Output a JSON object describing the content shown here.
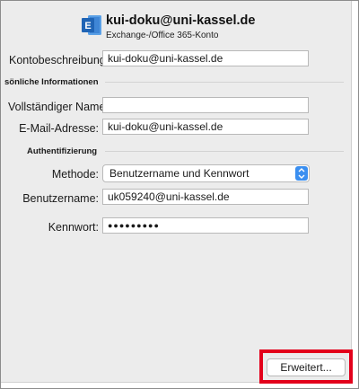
{
  "account": {
    "email": "kui-doku@uni-kassel.de",
    "type": "Exchange-/Office 365-Konto",
    "icon": "exchange-icon"
  },
  "fields": {
    "description_label": "Kontobeschreibung:",
    "description_value": "kui-doku@uni-kassel.de",
    "personal_section": "sönliche Informationen",
    "fullname_label": "Vollständiger Name:",
    "fullname_value": "",
    "email_label": "E-Mail-Adresse:",
    "email_value": "kui-doku@uni-kassel.de",
    "auth_section": "Authentifizierung",
    "method_label": "Methode:",
    "method_value": "Benutzername und Kennwort",
    "username_label": "Benutzername:",
    "username_value": "uk059240@uni-kassel.de",
    "password_label": "Kennwort:",
    "password_value": "●●●●●●●●●"
  },
  "buttons": {
    "advanced_label": "Erweitert..."
  },
  "colors": {
    "highlight": "#e3001b",
    "stepper": "#3b8ff0",
    "exchange_blue": "#1f64b5"
  }
}
